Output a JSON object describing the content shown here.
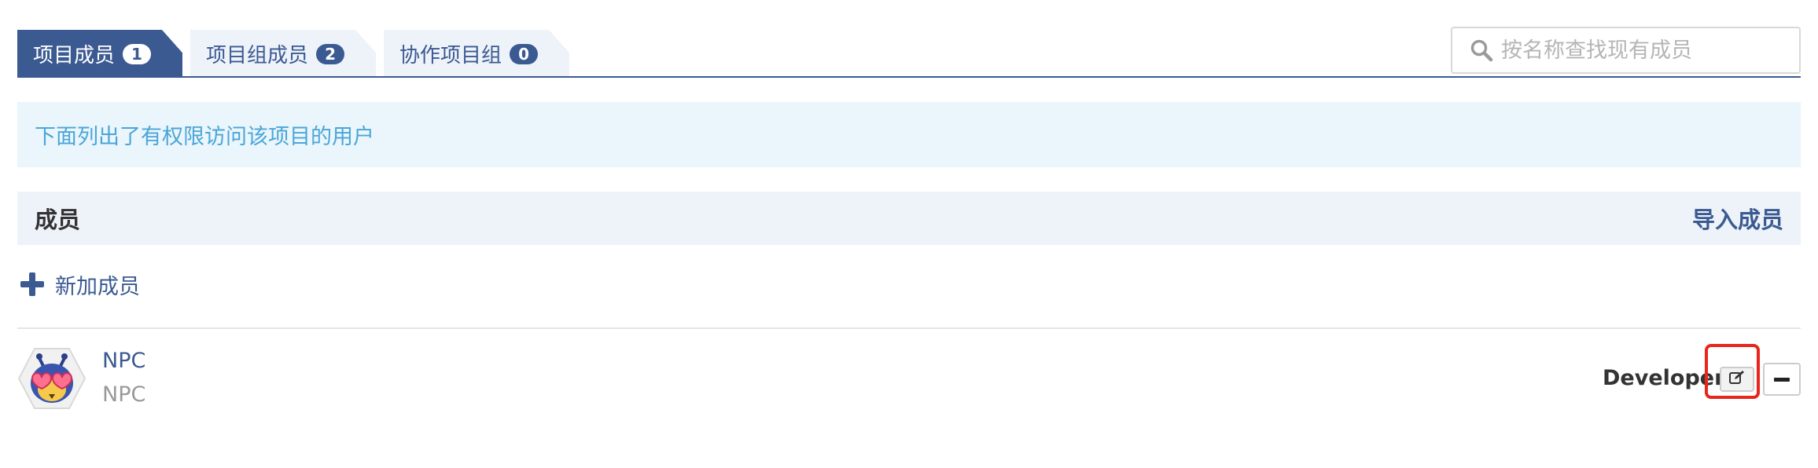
{
  "tabs": [
    {
      "label": "项目成员",
      "count": "1",
      "active": true
    },
    {
      "label": "项目组成员",
      "count": "2",
      "active": false
    },
    {
      "label": "协作项目组",
      "count": "0",
      "active": false
    }
  ],
  "search": {
    "placeholder": "按名称查找现有成员",
    "icon": "search-icon"
  },
  "info": {
    "text": "下面列出了有权限访问该项目的用户"
  },
  "section": {
    "title": "成员",
    "import_label": "导入成员"
  },
  "add_member": {
    "label": "新加成员",
    "icon": "plus-icon"
  },
  "members": [
    {
      "name": "NPC",
      "username": "NPC",
      "role": "Developer"
    }
  ],
  "colors": {
    "primary": "#3b5a92",
    "info_bg": "#eaf5fc",
    "info_text": "#4aa6d8",
    "section_bg": "#eef2f9",
    "highlight": "#e8261c"
  }
}
